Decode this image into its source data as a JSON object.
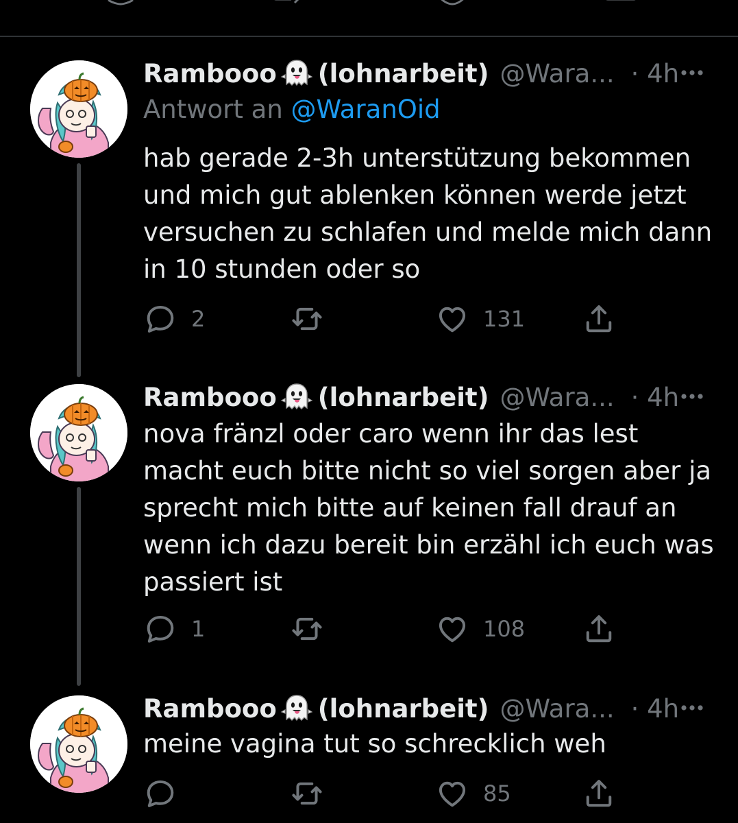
{
  "colors": {
    "background": "#000000",
    "text_primary": "#e7e9ea",
    "text_secondary": "#71767b",
    "link": "#1d9bf0",
    "divider": "#2f3336",
    "thread_line": "#3e4144"
  },
  "tweets": [
    {
      "display_name": "Rambooo",
      "display_name_suffix": "(lohnarbeit)",
      "name_emoji_icon": "ghost-tongue-emoji",
      "handle": "@Wara...",
      "time": "· 4h",
      "reply_prefix": "Antwort an",
      "reply_mention": "@WaranOid",
      "text": "hab gerade 2-3h unterstützung bekommen\nund mich gut ablenken können werde jetzt\nversuchen zu schlafen und melde mich dann\nin 10 stunden oder so",
      "replies": "2",
      "retweets": "",
      "likes": "131"
    },
    {
      "display_name": "Rambooo",
      "display_name_suffix": "(lohnarbeit)",
      "name_emoji_icon": "ghost-tongue-emoji",
      "handle": "@Wara...",
      "time": "· 4h",
      "text": "nova fränzl oder caro wenn ihr das lest\nmacht euch bitte nicht so viel sorgen aber ja\nsprecht mich bitte auf keinen fall drauf an\nwenn ich dazu bereit bin erzähl ich euch was\npassiert ist",
      "replies": "1",
      "retweets": "",
      "likes": "108"
    },
    {
      "display_name": "Rambooo",
      "display_name_suffix": "(lohnarbeit)",
      "name_emoji_icon": "ghost-tongue-emoji",
      "handle": "@Wara...",
      "time": "· 4h",
      "text": "meine vagina tut so schrecklich weh",
      "replies": "",
      "retweets": "",
      "likes": "85"
    }
  ]
}
